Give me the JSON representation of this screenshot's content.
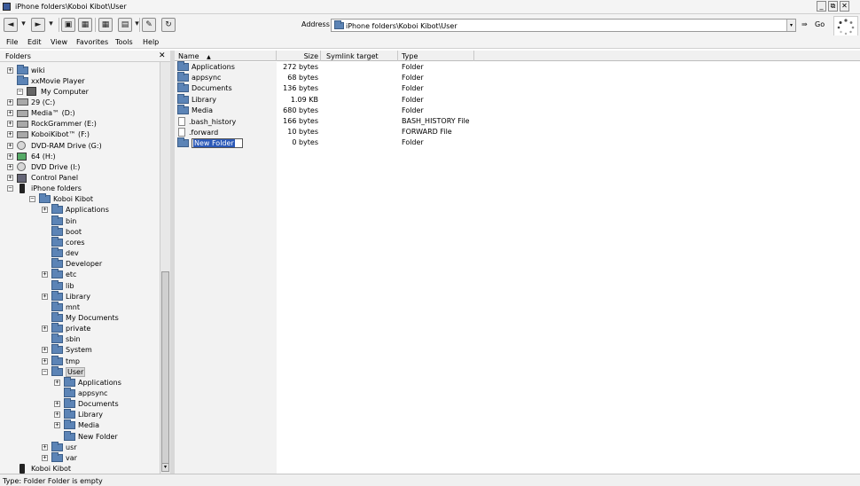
{
  "window": {
    "title": "iPhone folders\\Koboi Kibot\\User",
    "minimize_glyph": "_",
    "restore_glyph": "⧉",
    "close_glyph": "✕"
  },
  "toolbar": {
    "back_glyph": "◄",
    "back_drop_glyph": "▾",
    "forward_glyph": "►",
    "forward_drop_glyph": "▾",
    "up_glyph": "▣",
    "folders_glyph": "▦",
    "views_glyph": "▤",
    "views_drop_glyph": "▾",
    "properties_glyph": "✎",
    "refresh_glyph": "↻",
    "address_label": "Address",
    "address_value": "iPhone folders\\Koboi Kibot\\User",
    "address_drop_glyph": "▾",
    "go_arrow": "⇛",
    "go_label": "Go"
  },
  "menu": [
    "File",
    "Edit",
    "View",
    "Favorites",
    "Tools",
    "Help"
  ],
  "folders_pane": {
    "header": "Folders",
    "close_glyph": "✕",
    "scroll_down_glyph": "▾",
    "tree": [
      {
        "label": "wiki",
        "icon": "folder",
        "indent": 1,
        "expander": "+"
      },
      {
        "label": "xxMovie Player",
        "icon": "folder",
        "indent": 1,
        "expander": ""
      },
      {
        "label": "My Computer",
        "icon": "computer",
        "indent": 0,
        "expander": "−"
      },
      {
        "label": "29 (C:)",
        "icon": "drive",
        "indent": 1,
        "expander": "+"
      },
      {
        "label": "Media™ (D:)",
        "icon": "drive",
        "indent": 1,
        "expander": "+"
      },
      {
        "label": "RockGrammer (E:)",
        "icon": "drive",
        "indent": 1,
        "expander": "+"
      },
      {
        "label": "KoboiKibot™ (F:)",
        "icon": "drive",
        "indent": 1,
        "expander": "+"
      },
      {
        "label": "DVD-RAM Drive (G:)",
        "icon": "cd",
        "indent": 1,
        "expander": "+"
      },
      {
        "label": "64 (H:)",
        "icon": "usb",
        "indent": 1,
        "expander": "+"
      },
      {
        "label": "DVD Drive (I:)",
        "icon": "cd",
        "indent": 1,
        "expander": "+"
      },
      {
        "label": "Control Panel",
        "icon": "panel",
        "indent": 1,
        "expander": "+"
      },
      {
        "label": "iPhone folders",
        "icon": "phone",
        "indent": 1,
        "expander": "−"
      },
      {
        "label": "Koboi Kibot",
        "icon": "folder",
        "indent": 2,
        "expander": "−"
      },
      {
        "label": "Applications",
        "icon": "folder",
        "indent": 3,
        "expander": "+"
      },
      {
        "label": "bin",
        "icon": "folder",
        "indent": 3,
        "expander": ""
      },
      {
        "label": "boot",
        "icon": "folder",
        "indent": 3,
        "expander": ""
      },
      {
        "label": "cores",
        "icon": "folder",
        "indent": 3,
        "expander": ""
      },
      {
        "label": "dev",
        "icon": "folder",
        "indent": 3,
        "expander": ""
      },
      {
        "label": "Developer",
        "icon": "folder",
        "indent": 3,
        "expander": ""
      },
      {
        "label": "etc",
        "icon": "folder",
        "indent": 3,
        "expander": "+"
      },
      {
        "label": "lib",
        "icon": "folder",
        "indent": 3,
        "expander": ""
      },
      {
        "label": "Library",
        "icon": "folder",
        "indent": 3,
        "expander": "+"
      },
      {
        "label": "mnt",
        "icon": "folder",
        "indent": 3,
        "expander": ""
      },
      {
        "label": "My Documents",
        "icon": "folder",
        "indent": 3,
        "expander": ""
      },
      {
        "label": "private",
        "icon": "folder",
        "indent": 3,
        "expander": "+"
      },
      {
        "label": "sbin",
        "icon": "folder",
        "indent": 3,
        "expander": ""
      },
      {
        "label": "System",
        "icon": "folder",
        "indent": 3,
        "expander": "+"
      },
      {
        "label": "tmp",
        "icon": "folder",
        "indent": 3,
        "expander": "+"
      },
      {
        "label": "User",
        "icon": "folder",
        "indent": 3,
        "expander": "−",
        "selected": true
      },
      {
        "label": "Applications",
        "icon": "folder",
        "indent": 4,
        "expander": "+"
      },
      {
        "label": "appsync",
        "icon": "folder",
        "indent": 4,
        "expander": ""
      },
      {
        "label": "Documents",
        "icon": "folder",
        "indent": 4,
        "expander": "+"
      },
      {
        "label": "Library",
        "icon": "folder",
        "indent": 4,
        "expander": "+"
      },
      {
        "label": "Media",
        "icon": "folder",
        "indent": 4,
        "expander": "+"
      },
      {
        "label": "New Folder",
        "icon": "folder",
        "indent": 4,
        "expander": ""
      },
      {
        "label": "usr",
        "icon": "folder",
        "indent": 3,
        "expander": "+"
      },
      {
        "label": "var",
        "icon": "folder",
        "indent": 3,
        "expander": "+"
      },
      {
        "label": "Koboi Kibot",
        "icon": "phone",
        "indent": 1,
        "expander": ""
      }
    ]
  },
  "file_list": {
    "columns": {
      "name": "Name",
      "sort_glyph": "▲",
      "size": "Size",
      "symlink": "Symlink target",
      "type": "Type"
    },
    "rows": [
      {
        "name": "Applications",
        "icon": "folder",
        "size": "272 bytes",
        "type": "Folder"
      },
      {
        "name": "appsync",
        "icon": "folder",
        "size": "68 bytes",
        "type": "Folder"
      },
      {
        "name": "Documents",
        "icon": "folder",
        "size": "136 bytes",
        "type": "Folder"
      },
      {
        "name": "Library",
        "icon": "folder",
        "size": "1.09 KB",
        "type": "Folder"
      },
      {
        "name": "Media",
        "icon": "folder",
        "size": "680 bytes",
        "type": "Folder"
      },
      {
        "name": ".bash_history",
        "icon": "file",
        "size": "166 bytes",
        "type": "BASH_HISTORY File"
      },
      {
        "name": ".forward",
        "icon": "file",
        "size": "10 bytes",
        "type": "FORWARD File"
      },
      {
        "name": "New Folder",
        "icon": "folder",
        "size": "0 bytes",
        "type": "Folder",
        "renaming": true
      }
    ]
  },
  "status": "Type: Folder Folder is empty"
}
